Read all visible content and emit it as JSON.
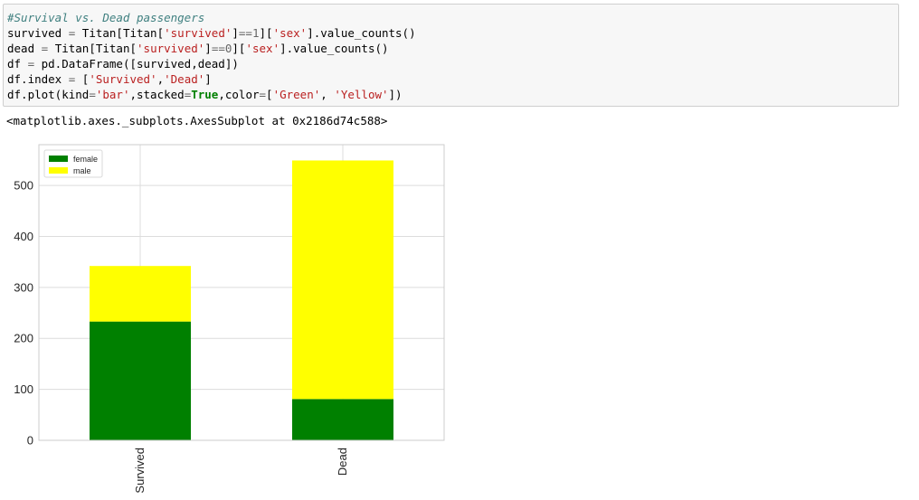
{
  "code_cell": {
    "lines": [
      [
        {
          "t": "#Survival vs. Dead passengers",
          "c": "comment"
        }
      ],
      [
        {
          "t": "survived ",
          "c": ""
        },
        {
          "t": "=",
          "c": "op"
        },
        {
          "t": " Titan[Titan[",
          "c": ""
        },
        {
          "t": "'survived'",
          "c": "str"
        },
        {
          "t": "]",
          "c": ""
        },
        {
          "t": "==",
          "c": "op"
        },
        {
          "t": "1",
          "c": "num"
        },
        {
          "t": "][",
          "c": ""
        },
        {
          "t": "'sex'",
          "c": "str"
        },
        {
          "t": "].value_counts()",
          "c": ""
        }
      ],
      [
        {
          "t": "dead ",
          "c": ""
        },
        {
          "t": "=",
          "c": "op"
        },
        {
          "t": " Titan[Titan[",
          "c": ""
        },
        {
          "t": "'survived'",
          "c": "str"
        },
        {
          "t": "]",
          "c": ""
        },
        {
          "t": "==",
          "c": "op"
        },
        {
          "t": "0",
          "c": "num"
        },
        {
          "t": "][",
          "c": ""
        },
        {
          "t": "'sex'",
          "c": "str"
        },
        {
          "t": "].value_counts()",
          "c": ""
        }
      ],
      [
        {
          "t": "df ",
          "c": ""
        },
        {
          "t": "=",
          "c": "op"
        },
        {
          "t": " pd.DataFrame([survived,dead])",
          "c": ""
        }
      ],
      [
        {
          "t": "df.index ",
          "c": ""
        },
        {
          "t": "=",
          "c": "op"
        },
        {
          "t": " [",
          "c": ""
        },
        {
          "t": "'Survived'",
          "c": "str"
        },
        {
          "t": ",",
          "c": ""
        },
        {
          "t": "'Dead'",
          "c": "str"
        },
        {
          "t": "]",
          "c": ""
        }
      ],
      [
        {
          "t": "df.plot(kind",
          "c": ""
        },
        {
          "t": "=",
          "c": "op"
        },
        {
          "t": "'bar'",
          "c": "str"
        },
        {
          "t": ",stacked",
          "c": ""
        },
        {
          "t": "=",
          "c": "op"
        },
        {
          "t": "True",
          "c": "kw"
        },
        {
          "t": ",color",
          "c": ""
        },
        {
          "t": "=",
          "c": "op"
        },
        {
          "t": "[",
          "c": ""
        },
        {
          "t": "'Green'",
          "c": "str"
        },
        {
          "t": ", ",
          "c": ""
        },
        {
          "t": "'Yellow'",
          "c": "str"
        },
        {
          "t": "])",
          "c": ""
        }
      ]
    ]
  },
  "output": {
    "text": "<matplotlib.axes._subplots.AxesSubplot at 0x2186d74c588>"
  },
  "colors": {
    "female": "#008000",
    "male": "#ffff00",
    "grid": "#dcdcdc",
    "axes_border": "#cccccc"
  },
  "chart_data": {
    "type": "bar",
    "stacked": true,
    "categories": [
      "Survived",
      "Dead"
    ],
    "series": [
      {
        "name": "female",
        "values": [
          233,
          81
        ],
        "color": "#008000"
      },
      {
        "name": "male",
        "values": [
          109,
          468
        ],
        "color": "#ffff00"
      }
    ],
    "ylim": [
      0,
      580
    ],
    "yticks": [
      0,
      100,
      200,
      300,
      400,
      500
    ],
    "grid": true,
    "legend_position": "top-left",
    "xtick_rotation": 90
  }
}
